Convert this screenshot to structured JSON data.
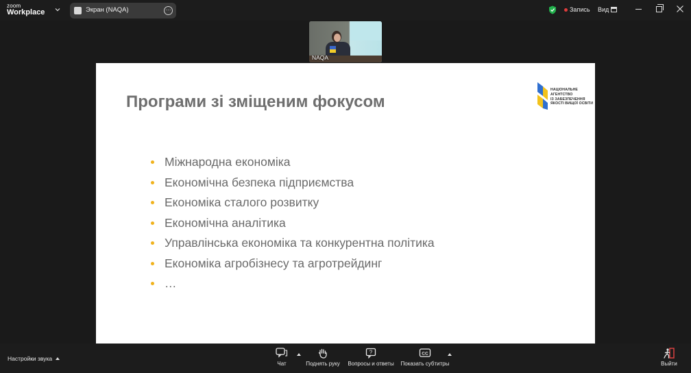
{
  "app": {
    "brand_top": "zoom",
    "brand_main": "Workplace"
  },
  "share": {
    "label": "Экран (NAQA)"
  },
  "status": {
    "recording_label": "Запись",
    "view_label": "Вид",
    "recording_color": "#e03c3c",
    "shield_color": "#22b14c"
  },
  "participant": {
    "name": "NAQA"
  },
  "slide": {
    "title": "Програми зі зміщеним фокусом",
    "logo_lines": [
      "НАЦІОНАЛЬНЕ",
      "АГЕНТСТВО",
      "ІЗ ЗАБЕЗПЕЧЕННЯ",
      "ЯКОСТІ ВИЩОЇ ОСВІТИ"
    ],
    "bullet_color": "#f0b21c",
    "bullets": [
      "Міжнародна економіка",
      "Економічна безпека підприємства",
      "Економіка сталого розвитку",
      "Економічна аналітика",
      "Управлінська економіка та конкурентна політика",
      "Економіка агробізнесу та агротрейдинг",
      "…"
    ]
  },
  "toolbar": {
    "audio_settings": "Настройки звука",
    "chat": "Чат",
    "raise_hand": "Поднять руку",
    "qa": "Вопросы и ответы",
    "captions": "Показать субтитры",
    "leave": "Выйти",
    "captions_icon_text": "CC"
  }
}
